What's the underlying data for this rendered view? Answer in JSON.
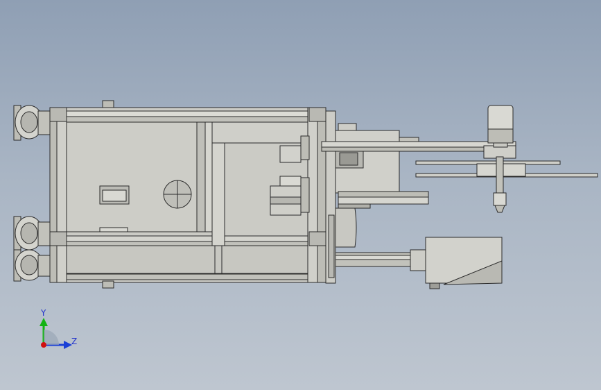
{
  "viewport": {
    "background_top": "#8f9fb4",
    "background_bottom": "#bec6d0",
    "model_fill": "#c9c9c3",
    "model_stroke": "#2a2a2a"
  },
  "triad": {
    "y_label": "Y",
    "z_label": "Z",
    "x_color": "#d01010",
    "y_color": "#12b312",
    "z_color": "#1a3fd6"
  }
}
